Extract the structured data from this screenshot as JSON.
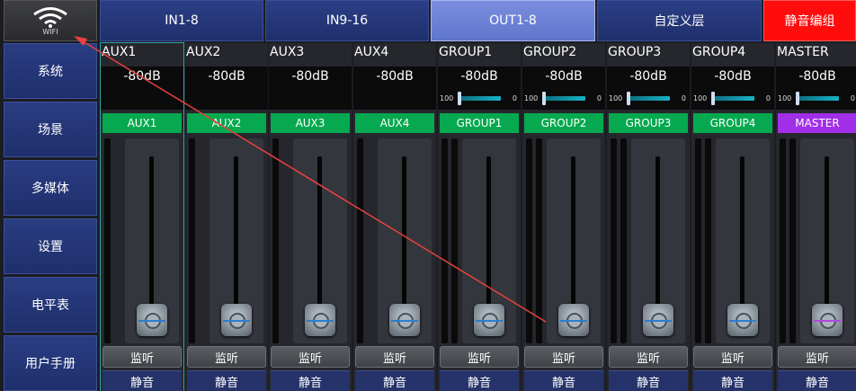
{
  "wifi": {
    "icon": "wifi-icon",
    "label": "WIFI"
  },
  "sidebar": {
    "items": [
      "系统",
      "场景",
      "多媒体",
      "设置",
      "电平表",
      "用户手册"
    ]
  },
  "tabs": [
    "IN1-8",
    "IN9-16",
    "OUT1-8",
    "自定义层",
    "静音编组"
  ],
  "active_tab": "OUT1-8",
  "channels": [
    {
      "name": "AUX1",
      "level": "-80dB",
      "badge": "AUX1",
      "listen": "监听",
      "mute": "静音"
    },
    {
      "name": "AUX2",
      "level": "-80dB",
      "badge": "AUX2",
      "listen": "监听",
      "mute": "静音"
    },
    {
      "name": "AUX3",
      "level": "-80dB",
      "badge": "AUX3",
      "listen": "监听",
      "mute": "静音"
    },
    {
      "name": "AUX4",
      "level": "-80dB",
      "badge": "AUX4",
      "listen": "监听",
      "mute": "静音"
    },
    {
      "name": "GROUP1",
      "level": "-80dB",
      "pan_left": "100",
      "pan_right": "0",
      "badge": "GROUP1",
      "listen": "监听",
      "mute": "静音"
    },
    {
      "name": "GROUP2",
      "level": "-80dB",
      "pan_left": "100",
      "pan_right": "0",
      "badge": "GROUP2",
      "listen": "监听",
      "mute": "静音"
    },
    {
      "name": "GROUP3",
      "level": "-80dB",
      "pan_left": "100",
      "pan_right": "0",
      "badge": "GROUP3",
      "listen": "监听",
      "mute": "静音"
    },
    {
      "name": "GROUP4",
      "level": "-80dB",
      "pan_left": "100",
      "pan_right": "0",
      "badge": "GROUP4",
      "listen": "监听",
      "mute": "静音"
    },
    {
      "name": "MASTER",
      "level": "-80dB",
      "pan_left": "100",
      "pan_right": "0",
      "badge": "MASTER",
      "listen": "监听",
      "mute": "静音"
    }
  ],
  "colors": {
    "badge_green": "#06a94f",
    "badge_master": "#a12fe8",
    "active_tab": "#6f83d8",
    "mute_tab": "#ff0d0d",
    "annotation_arrow": "#e8413f"
  }
}
